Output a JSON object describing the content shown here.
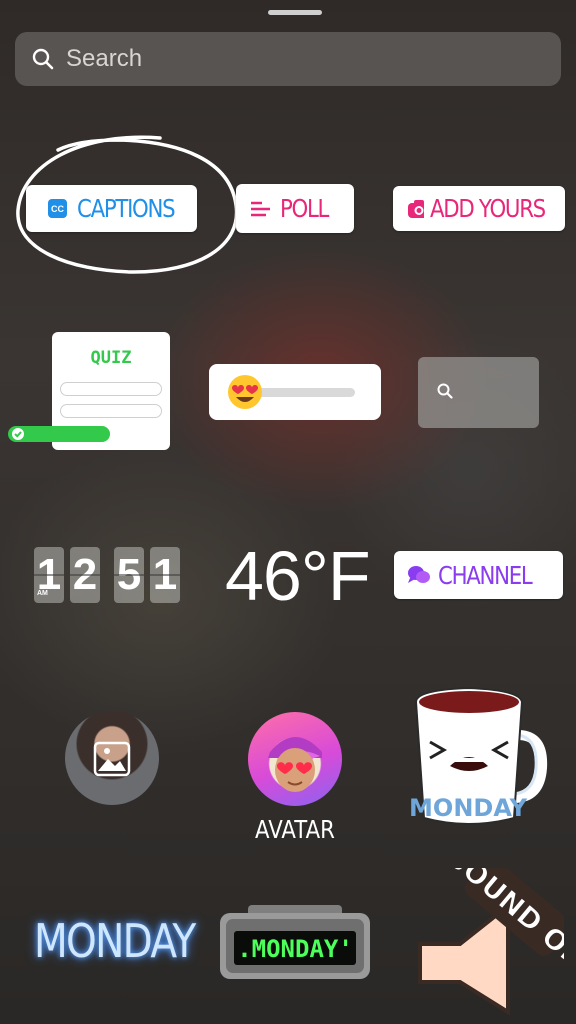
{
  "search": {
    "placeholder": "Search"
  },
  "stickers": {
    "captions": "CAPTIONS",
    "poll": "POLL",
    "add_yours": "ADD YOURS",
    "quiz": "QUIZ",
    "clock": {
      "digits": [
        "1",
        "2",
        "5",
        "1"
      ],
      "ampm": "AM"
    },
    "temperature": "46°F",
    "channel": "CHANNEL",
    "avatar": "AVATAR",
    "mug_label": "MONDAY",
    "monday_neon": "MONDAY",
    "monday_lcd": ".MONDAY'",
    "sound_on": "SOUND ON"
  },
  "colors": {
    "captions": "#1f8fe8",
    "poll": "#e8277a",
    "quiz": "#33c94a",
    "channel": "#8a3cf0"
  }
}
